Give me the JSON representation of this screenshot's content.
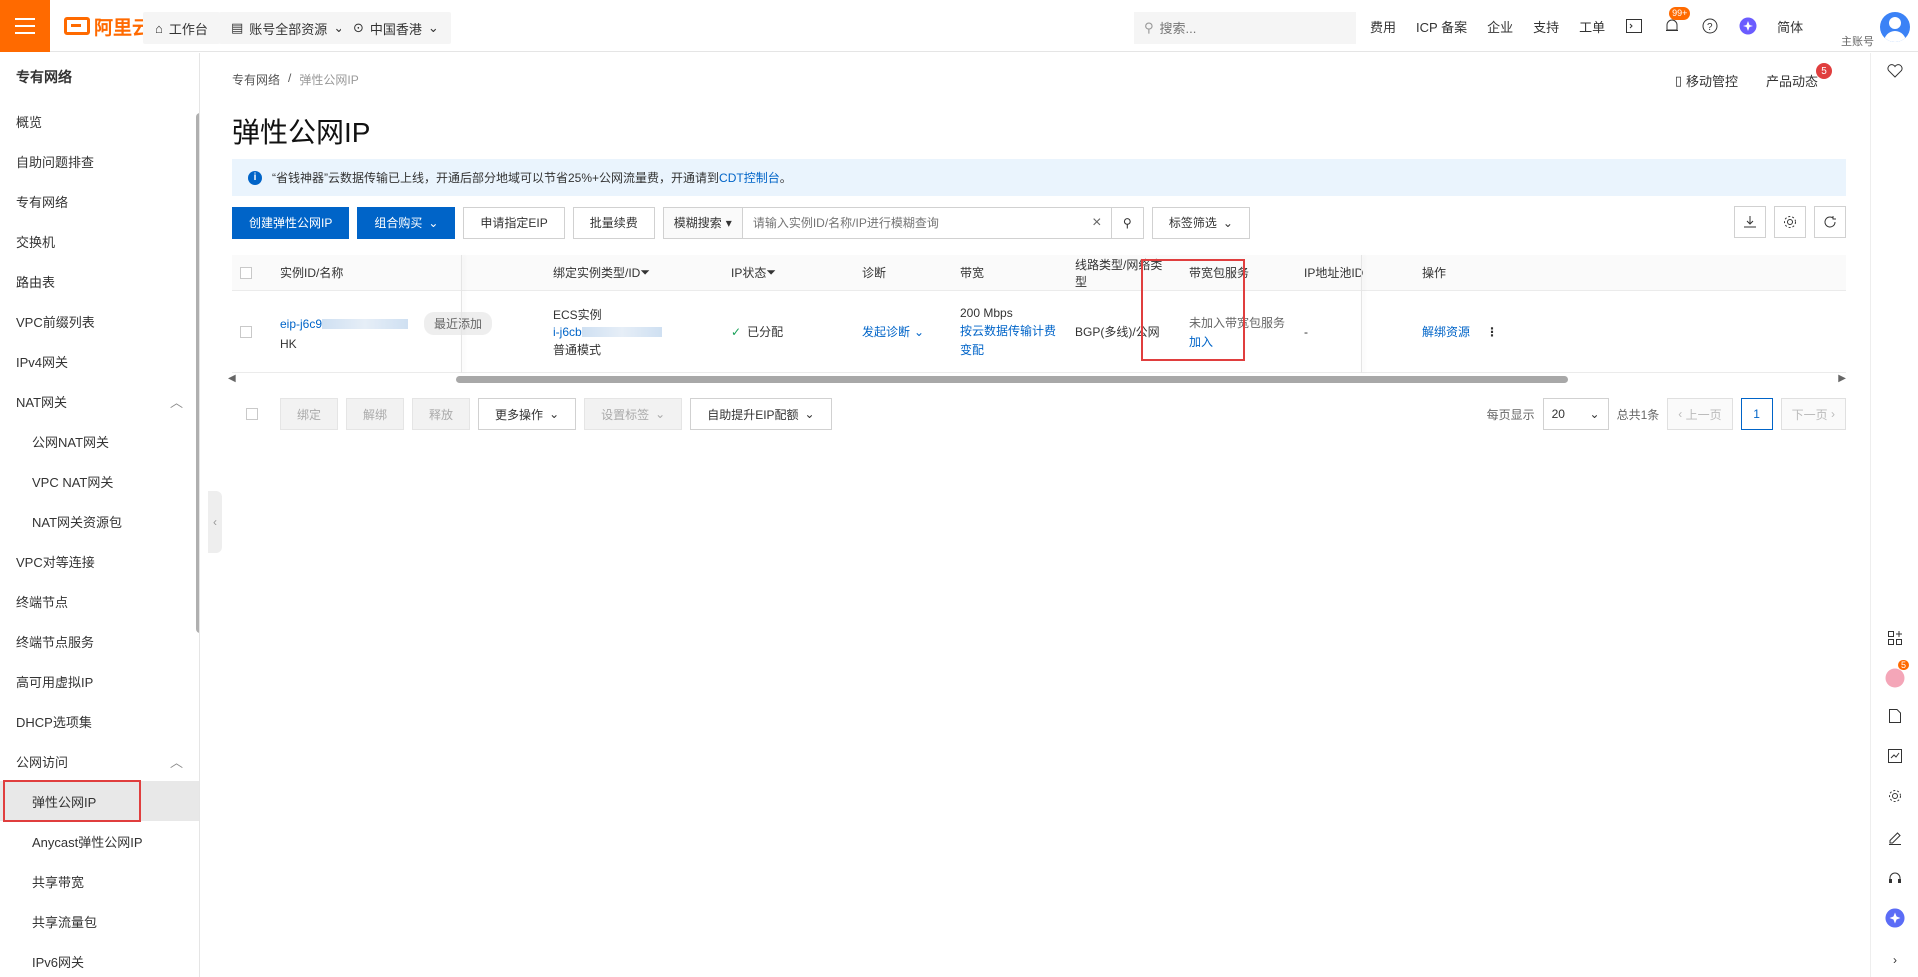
{
  "top": {
    "logo_text": "阿里云",
    "workbench": "工作台",
    "account_resources": "账号全部资源",
    "region": "中国香港",
    "search_placeholder": "搜索...",
    "links": [
      "费用",
      "ICP 备案",
      "企业",
      "支持",
      "工单"
    ],
    "notif_badge": "99+",
    "lang": "简体",
    "account_label": "主账号"
  },
  "sidebar": {
    "title": "专有网络",
    "items": [
      {
        "label": "概览",
        "sub": false
      },
      {
        "label": "自助问题排查",
        "sub": false
      },
      {
        "label": "专有网络",
        "sub": false
      },
      {
        "label": "交换机",
        "sub": false
      },
      {
        "label": "路由表",
        "sub": false
      },
      {
        "label": "VPC前缀列表",
        "sub": false
      },
      {
        "label": "IPv4网关",
        "sub": false
      },
      {
        "label": "NAT网关",
        "sub": false,
        "group": true
      },
      {
        "label": "公网NAT网关",
        "sub": true
      },
      {
        "label": "VPC NAT网关",
        "sub": true
      },
      {
        "label": "NAT网关资源包",
        "sub": true
      },
      {
        "label": "VPC对等连接",
        "sub": false
      },
      {
        "label": "终端节点",
        "sub": false
      },
      {
        "label": "终端节点服务",
        "sub": false
      },
      {
        "label": "高可用虚拟IP",
        "sub": false
      },
      {
        "label": "DHCP选项集",
        "sub": false
      },
      {
        "label": "公网访问",
        "sub": false,
        "group": true
      },
      {
        "label": "弹性公网IP",
        "sub": true,
        "active": true
      },
      {
        "label": "Anycast弹性公网IP",
        "sub": true
      },
      {
        "label": "共享带宽",
        "sub": true
      },
      {
        "label": "共享流量包",
        "sub": true
      },
      {
        "label": "IPv6网关",
        "sub": true
      }
    ]
  },
  "breadcrumb": [
    "专有网络",
    "弹性公网IP"
  ],
  "page_title": "弹性公网IP",
  "header_actions": {
    "mobile": "移动管控",
    "news": "产品动态",
    "news_count": "5"
  },
  "notice": {
    "text": "“省钱神器”云数据传输已上线，开通后部分地域可以节省25%+公网流量费，开通请到",
    "link": "CDT控制台",
    "suffix": "。"
  },
  "toolbar": {
    "create": "创建弹性公网IP",
    "combo_buy": "组合购买",
    "apply_ip": "申请指定EIP",
    "batch_renew": "批量续费",
    "fuzzy": "模糊搜索",
    "search_placeholder": "请输入实例ID/名称/IP进行模糊查询",
    "tag_filter": "标签筛选"
  },
  "table": {
    "headers": [
      "实例ID/名称",
      "绑定实例类型/ID",
      "IP状态",
      "诊断",
      "带宽",
      "线路类型/网络类型",
      "带宽包服务",
      "IP地址池ID",
      "操作"
    ],
    "row": {
      "id": "eip-j6c9",
      "region": "HK",
      "recent_tag": "最近添加",
      "bind_type": "ECS实例",
      "bind_id": "i-j6cb",
      "mode": "普通模式",
      "status": "已分配",
      "diagnose": "发起诊断",
      "bandwidth": "200 Mbps",
      "billing": "按云数据传输计费",
      "change": "变配",
      "line": "BGP(多线)/公网",
      "bwp_status": "未加入带宽包服务",
      "bwp_join": "加入",
      "pool": "-",
      "action": "解绑资源"
    }
  },
  "bottom": {
    "bind": "绑定",
    "unbind": "解绑",
    "release": "释放",
    "more": "更多操作",
    "set_tag": "设置标签",
    "quota": "自助提升EIP配额",
    "per_page_label": "每页显示",
    "per_page": "20",
    "total": "总共1条",
    "prev": "上一页",
    "page": "1",
    "next": "下一页"
  },
  "rail_badge": "5",
  "colors": {
    "brand": "#ff6a00",
    "primary": "#0064c8",
    "highlight": "#e03e3e"
  }
}
